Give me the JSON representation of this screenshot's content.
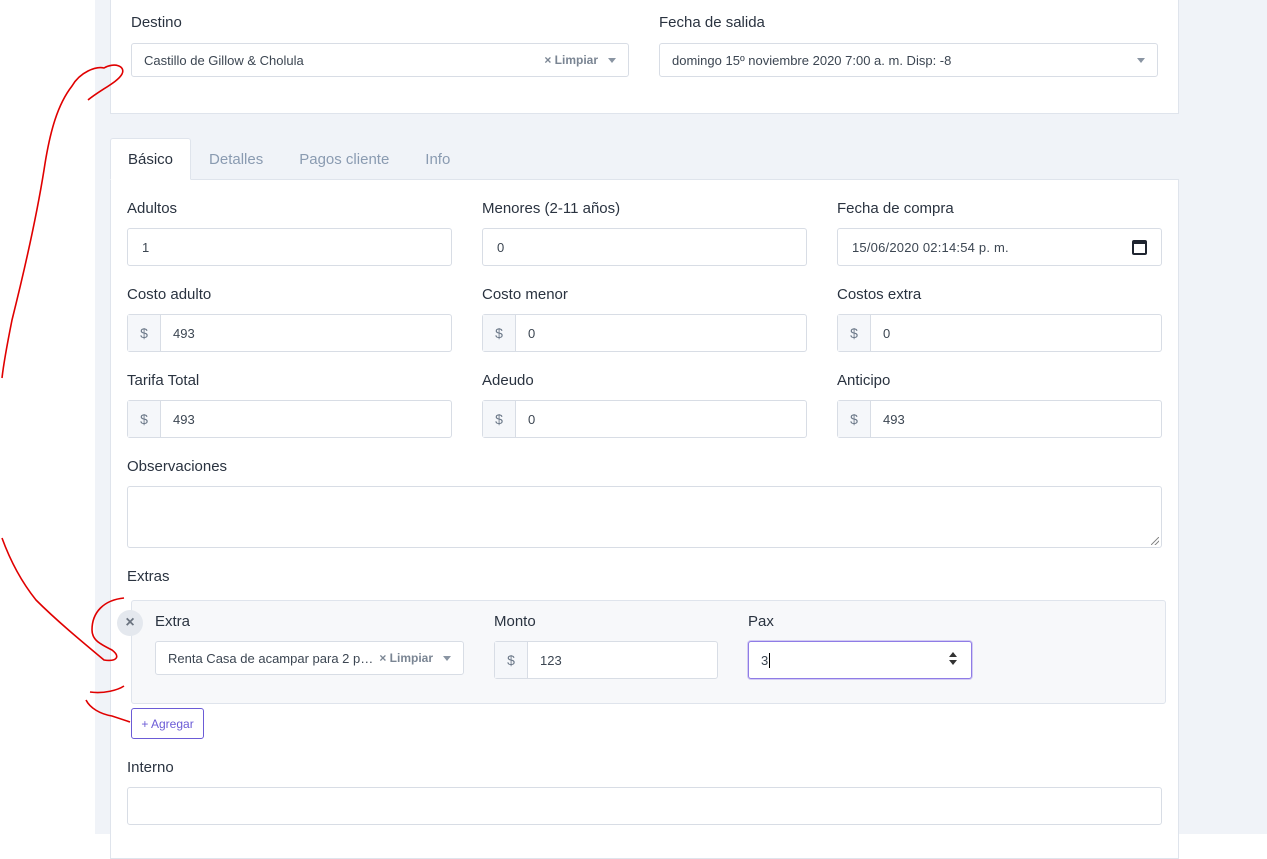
{
  "top": {
    "destino_label": "Destino",
    "destino_value": "Castillo de Gillow & Cholula",
    "destino_clear": "× Limpiar",
    "fecha_salida_label": "Fecha de salida",
    "fecha_salida_value": "domingo 15º noviembre 2020 7:00 a. m. Disp: -8"
  },
  "tabs": [
    {
      "label": "Básico",
      "active": true
    },
    {
      "label": "Detalles",
      "active": false
    },
    {
      "label": "Pagos cliente",
      "active": false
    },
    {
      "label": "Info",
      "active": false
    }
  ],
  "form": {
    "adultos_label": "Adultos",
    "adultos_value": "1",
    "menores_label": "Menores (2-11 años)",
    "menores_value": "0",
    "fecha_compra_label": "Fecha de compra",
    "fecha_compra_value": "15/06/2020 02:14:54 p. m.",
    "currency_symbol": "$",
    "costo_adulto_label": "Costo adulto",
    "costo_adulto_value": "493",
    "costo_menor_label": "Costo menor",
    "costo_menor_value": "0",
    "costos_extra_label": "Costos extra",
    "costos_extra_value": "0",
    "tarifa_total_label": "Tarifa Total",
    "tarifa_total_value": "493",
    "adeudo_label": "Adeudo",
    "adeudo_value": "0",
    "anticipo_label": "Anticipo",
    "anticipo_value": "493",
    "observaciones_label": "Observaciones",
    "extras_label": "Extras",
    "interno_label": "Interno"
  },
  "extra_item": {
    "remove_glyph": "×",
    "extra_label": "Extra",
    "extra_value": "Renta Casa de acampar para 2 p…",
    "extra_clear": "× Limpiar",
    "monto_label": "Monto",
    "monto_value": "123",
    "pax_label": "Pax",
    "pax_value": "3"
  },
  "add_button_label": "+ Agregar",
  "colors": {
    "accent": "#6b5bd6",
    "annotation": "#e00000",
    "page_bg": "#f0f3f8"
  }
}
